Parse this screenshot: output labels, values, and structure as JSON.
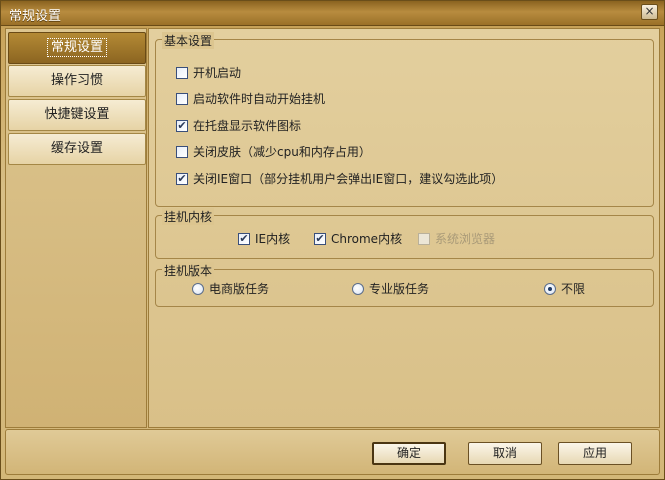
{
  "window": {
    "title": "常规设置",
    "close_glyph": "×"
  },
  "sidebar": {
    "tabs": [
      {
        "label": "常规设置",
        "active": true
      },
      {
        "label": "操作习惯",
        "active": false
      },
      {
        "label": "快捷键设置",
        "active": false
      },
      {
        "label": "缓存设置",
        "active": false
      }
    ]
  },
  "basic_settings": {
    "title": "基本设置",
    "options": [
      {
        "label": "开机启动",
        "checked": false
      },
      {
        "label": "启动软件时自动开始挂机",
        "checked": false
      },
      {
        "label": "在托盘显示软件图标",
        "checked": true
      },
      {
        "label": "关闭皮肤（减少cpu和内存占用）",
        "checked": false
      },
      {
        "label": "关闭IE窗口（部分挂机用户会弹出IE窗口，建议勾选此项）",
        "checked": true
      }
    ]
  },
  "kernel": {
    "title": "挂机内核",
    "options": [
      {
        "label": "IE内核",
        "checked": true,
        "enabled": true
      },
      {
        "label": "Chrome内核",
        "checked": true,
        "enabled": true
      },
      {
        "label": "系统浏览器",
        "checked": false,
        "enabled": false
      }
    ]
  },
  "version": {
    "title": "挂机版本",
    "options": [
      {
        "label": "电商版任务",
        "selected": false
      },
      {
        "label": "专业版任务",
        "selected": false
      },
      {
        "label": "不限",
        "selected": true
      }
    ]
  },
  "buttons": {
    "ok": "确定",
    "cancel": "取消",
    "apply": "应用"
  },
  "check_glyph": "✔"
}
